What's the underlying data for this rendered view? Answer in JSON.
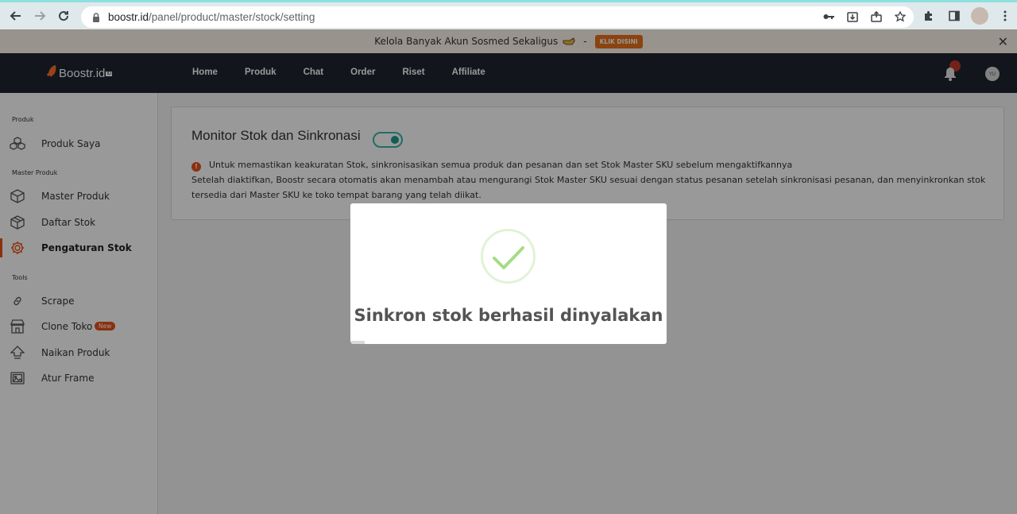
{
  "browser": {
    "url_host": "boostr.id",
    "url_path": "/panel/product/master/stock/setting"
  },
  "announcement": {
    "text": "Kelola Banyak Akun Sosmed Sekaligus",
    "separator": "-",
    "cta": "KLIK DISINI",
    "close": "✕"
  },
  "brand": {
    "name": "Boostr.id",
    "badge": "ID"
  },
  "topnav": {
    "items": [
      "Home",
      "Produk",
      "Chat",
      "Order",
      "Riset",
      "Affiliate"
    ],
    "user_initials": "YU"
  },
  "sidebar": {
    "sections": [
      {
        "title": "Produk"
      },
      {
        "title": "Master Produk"
      },
      {
        "title": "Tools"
      }
    ],
    "items": [
      {
        "label": "Produk Saya",
        "icon": "boxes-icon"
      },
      {
        "label": "Master Produk",
        "icon": "box-icon"
      },
      {
        "label": "Daftar Stok",
        "icon": "box-icon"
      },
      {
        "label": "Pengaturan Stok",
        "icon": "gear-icon",
        "active": true
      },
      {
        "label": "Scrape",
        "icon": "link-icon"
      },
      {
        "label": "Clone Toko",
        "icon": "store-icon",
        "badge": "New"
      },
      {
        "label": "Naikan Produk",
        "icon": "arrow-up-icon"
      },
      {
        "label": "Atur Frame",
        "icon": "image-icon"
      }
    ]
  },
  "main": {
    "title": "Monitor Stok dan Sinkronasi",
    "toggle_on": true,
    "warning": "Untuk memastikan keakuratan Stok, sinkronisasikan semua produk dan pesanan dan set Stok Master SKU sebelum mengaktifkannya",
    "description": "Setelah diaktifkan, Boostr secara otomatis akan menambah atau mengurangi Stok Master SKU sesuai dengan status pesanan setelah sinkronisasi pesanan, dan menyinkronkan stok tersedia dari Master SKU ke toko tempat barang yang telah diikat."
  },
  "modal": {
    "message": "Sinkron stok berhasil dinyalakan"
  },
  "colors": {
    "accent": "#e8501a",
    "toggle": "#1b9b8f",
    "nav_bg": "#1e2330",
    "success": "#a5dc86"
  }
}
